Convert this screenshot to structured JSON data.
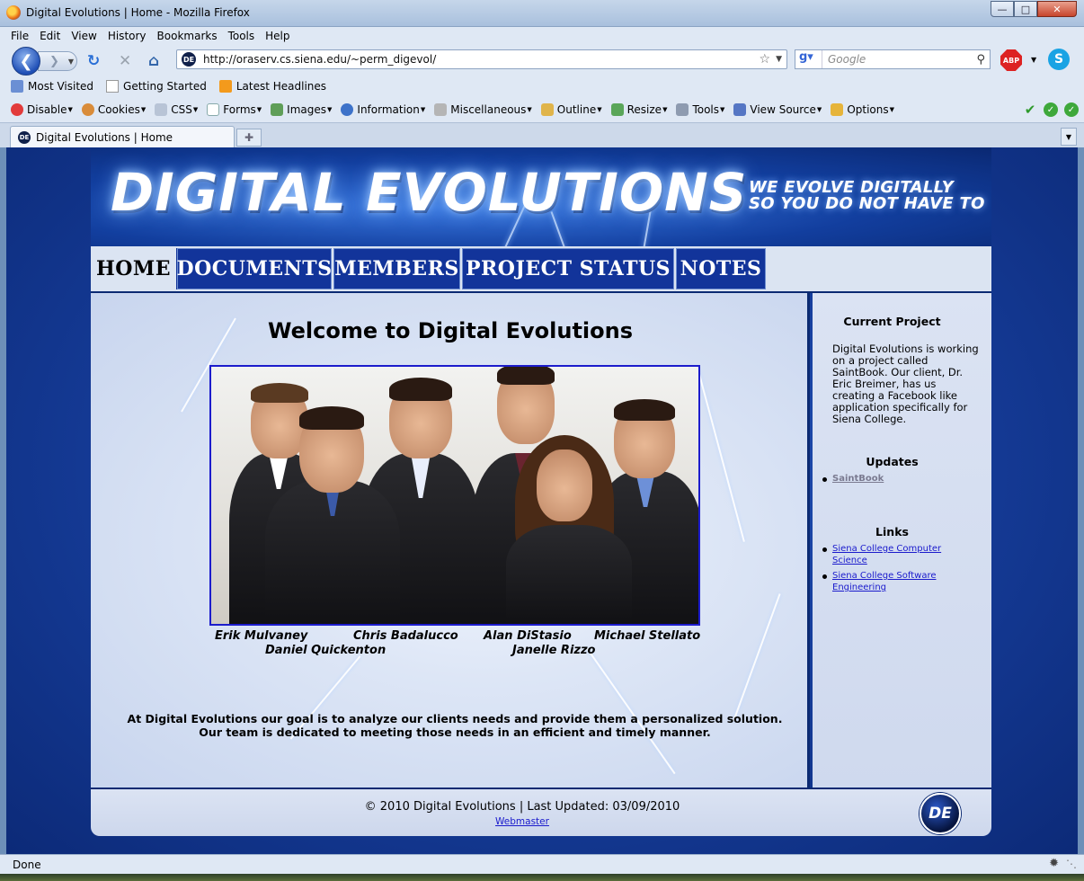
{
  "window": {
    "title": "Digital Evolutions | Home - Mozilla Firefox"
  },
  "menubar": [
    "File",
    "Edit",
    "View",
    "History",
    "Bookmarks",
    "Tools",
    "Help"
  ],
  "navbar": {
    "url": "http://oraserv.cs.siena.edu/~perm_digevol/",
    "search_placeholder": "Google",
    "abp_label": "ABP"
  },
  "bookmarks": [
    "Most Visited",
    "Getting Started",
    "Latest Headlines"
  ],
  "devtoolbar": [
    "Disable",
    "Cookies",
    "CSS",
    "Forms",
    "Images",
    "Information",
    "Miscellaneous",
    "Outline",
    "Resize",
    "Tools",
    "View Source",
    "Options"
  ],
  "tab": {
    "label": "Digital Evolutions | Home"
  },
  "site": {
    "logo": "DIGITAL EVOLUTIONS",
    "slogan_line1": "WE EVOLVE DIGITALLY",
    "slogan_line2": "SO YOU DO NOT HAVE TO",
    "nav": [
      "Home",
      "Documents",
      "Members",
      "Project Status",
      "Notes"
    ],
    "welcome": "Welcome to Digital Evolutions",
    "names": [
      "Erik Mulvaney",
      "Chris Badalucco",
      "Alan DiStasio",
      "Michael Stellato",
      "Daniel Quickenton",
      "Janelle Rizzo"
    ],
    "mission_line1": "At Digital Evolutions our goal is to analyze our clients needs and provide them a personalized solution.",
    "mission_line2": "Our team is dedicated to meeting those needs in an efficient and timely manner.",
    "sidebar": {
      "current_project_title": "Current Project",
      "current_project_text": "Digital Evolutions is working on a project called SaintBook. Our client, Dr. Eric Breimer, has us creating a Facebook like application specifically for Siena College.",
      "updates_title": "Updates",
      "updates": [
        "SaintBook"
      ],
      "links_title": "Links",
      "links": [
        "Siena College Computer Science",
        "Siena College Software Engineering"
      ]
    },
    "footer": {
      "copyright": "© 2010 Digital Evolutions | Last Updated: 03/09/2010",
      "webmaster": "Webmaster",
      "badge": "DE"
    }
  },
  "status": {
    "text": "Done"
  }
}
